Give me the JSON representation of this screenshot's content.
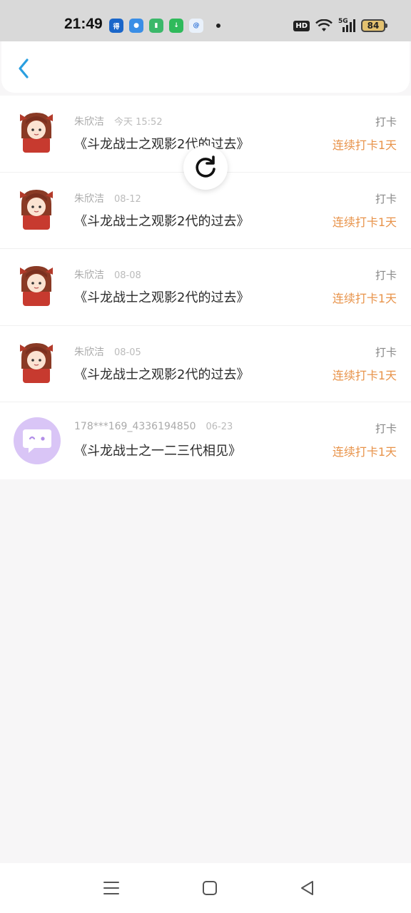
{
  "status_bar": {
    "time": "21:49",
    "hd": "HD",
    "network": "5G",
    "battery": "84"
  },
  "header": {
    "back_icon": "chevron-left-icon"
  },
  "records": [
    {
      "user": "朱欣洁",
      "date": "今天 15:52",
      "title": "《斗龙战士之观影2代的过去》",
      "action": "打卡",
      "streak": "连续打卡1天",
      "avatar": "anime-character"
    },
    {
      "user": "朱欣洁",
      "date": "08-12",
      "title": "《斗龙战士之观影2代的过去》",
      "action": "打卡",
      "streak": "连续打卡1天",
      "avatar": "anime-character"
    },
    {
      "user": "朱欣洁",
      "date": "08-08",
      "title": "《斗龙战士之观影2代的过去》",
      "action": "打卡",
      "streak": "连续打卡1天",
      "avatar": "anime-character"
    },
    {
      "user": "朱欣洁",
      "date": "08-05",
      "title": "《斗龙战士之观影2代的过去》",
      "action": "打卡",
      "streak": "连续打卡1天",
      "avatar": "anime-character"
    },
    {
      "user": "178***169_4336194850",
      "date": "06-23",
      "title": "《斗龙战士之一二三代相见》",
      "action": "打卡",
      "streak": "连续打卡1天",
      "avatar": "chat-bubble"
    }
  ],
  "colors": {
    "accent": "#2a9fe0",
    "streak": "#e8934a",
    "avatar_bubble": "#d9c5f6"
  }
}
